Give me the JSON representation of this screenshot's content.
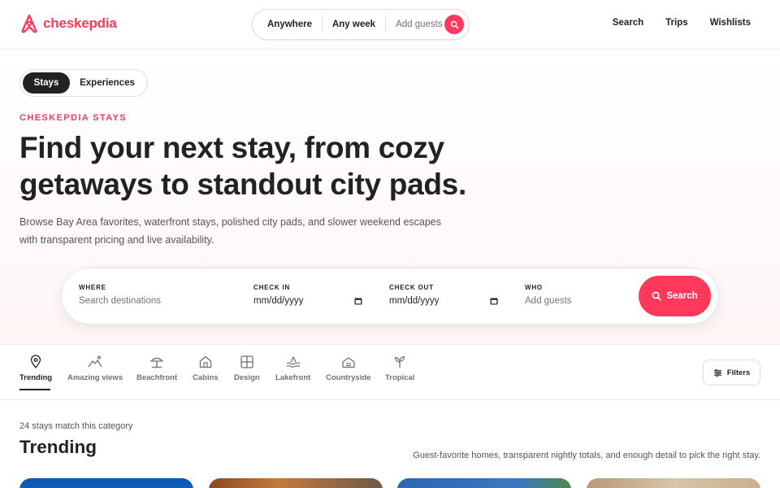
{
  "brand": {
    "name": "cheskepdia",
    "accent": "#ff385c"
  },
  "header": {
    "pill": {
      "where": "Anywhere",
      "when": "Any week",
      "guests": "Add guests"
    },
    "nav": [
      "Search",
      "Trips",
      "Wishlists"
    ]
  },
  "hero": {
    "toggle": {
      "active": "Stays",
      "inactive": "Experiences"
    },
    "eyebrow": "CHESKEPDIA STAYS",
    "headline": "Find your next stay, from cozy getaways to standout city pads.",
    "subtext": "Browse Bay Area favorites, waterfront stays, polished city pads, and slower weekend escapes with transparent pricing and live availability."
  },
  "search": {
    "where_label": "WHERE",
    "where_placeholder": "Search destinations",
    "checkin_label": "CHECK IN",
    "checkin_value": "mm/dd/yyyy",
    "checkout_label": "CHECK OUT",
    "checkout_value": "mm/dd/yyyy",
    "who_label": "WHO",
    "who_placeholder": "Add guests",
    "button": "Search"
  },
  "categories": {
    "items": [
      {
        "label": "Trending",
        "icon": "map-pin-icon",
        "active": true
      },
      {
        "label": "Amazing views",
        "icon": "mountain-icon",
        "active": false
      },
      {
        "label": "Beachfront",
        "icon": "umbrella-icon",
        "active": false
      },
      {
        "label": "Cabins",
        "icon": "house-icon",
        "active": false
      },
      {
        "label": "Design",
        "icon": "grid-icon",
        "active": false
      },
      {
        "label": "Lakefront",
        "icon": "waves-icon",
        "active": false
      },
      {
        "label": "Countryside",
        "icon": "barn-icon",
        "active": false
      },
      {
        "label": "Tropical",
        "icon": "sprout-icon",
        "active": false
      }
    ],
    "filters": "Filters"
  },
  "results": {
    "count": "24 stays match this category",
    "title": "Trending",
    "subtitle": "Guest-favorite homes, transparent nightly totals, and enough detail to pick the right stay."
  }
}
